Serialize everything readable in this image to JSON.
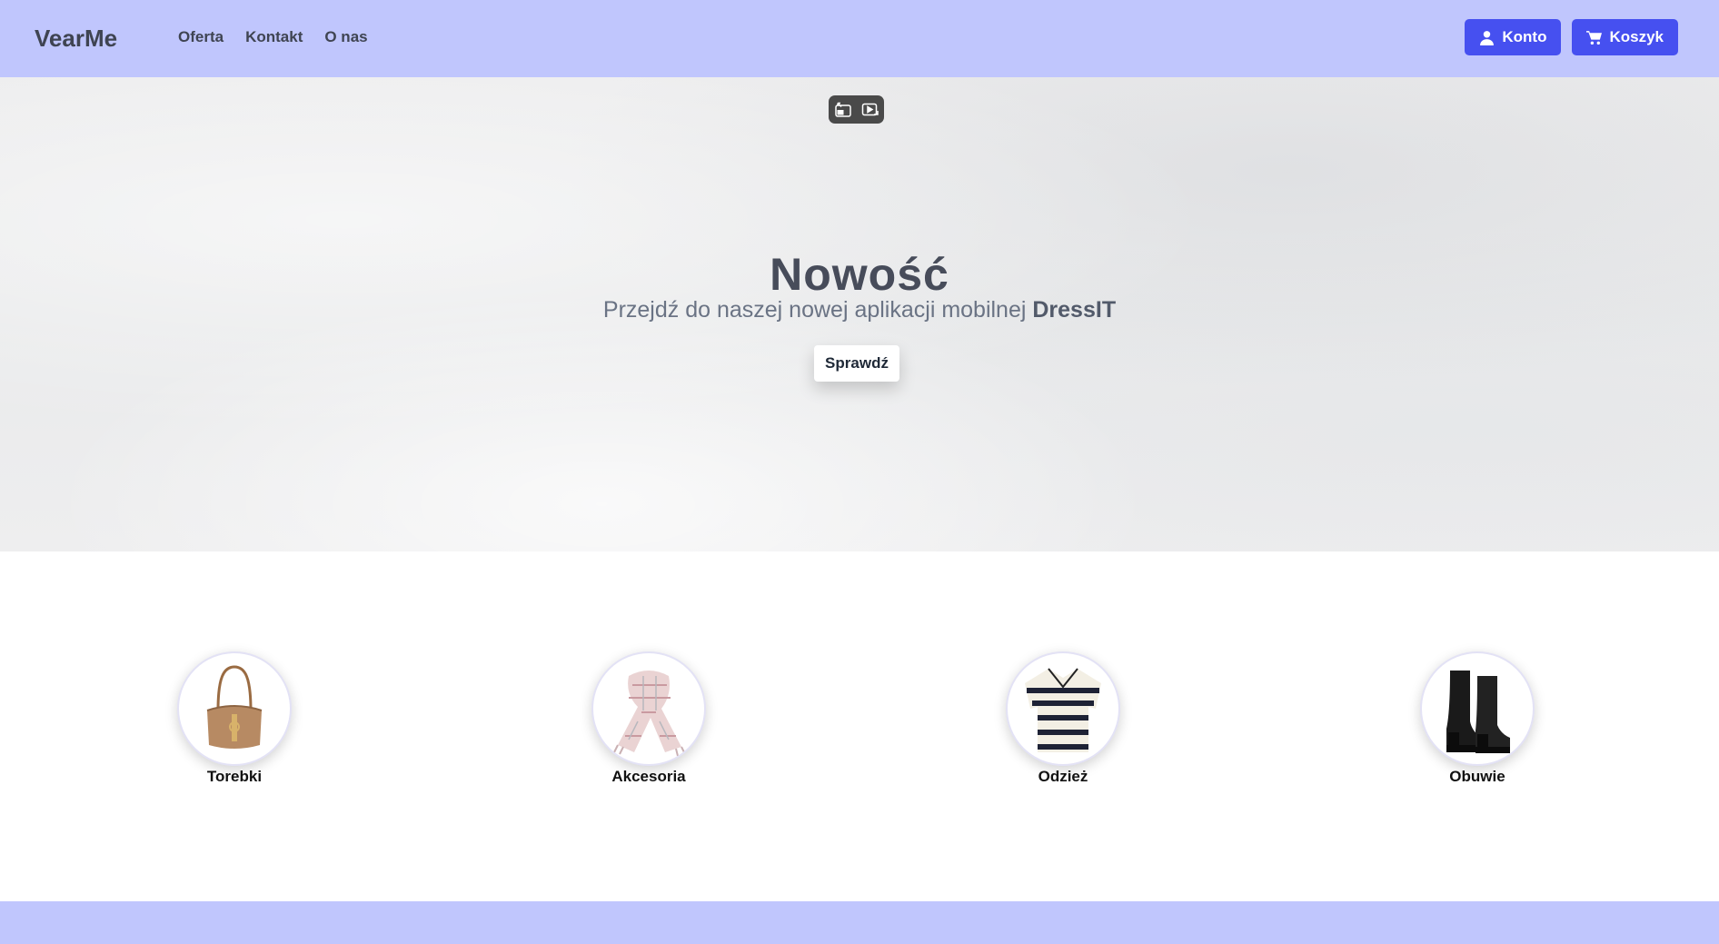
{
  "brand": "VearMe",
  "nav": {
    "links": [
      "Oferta",
      "Kontakt",
      "O nas"
    ],
    "account_label": "Konto",
    "cart_label": "Koszyk"
  },
  "hero": {
    "title": "Nowość",
    "subtitle_prefix": "Przejdź do naszej nowej aplikacji mobilnej",
    "subtitle_brand": "DressIT",
    "button_label": "Sprawdź"
  },
  "categories": [
    {
      "label": "Torebki",
      "icon": "handbag-icon"
    },
    {
      "label": "Akcesoria",
      "icon": "scarf-icon"
    },
    {
      "label": "Odzież",
      "icon": "striped-shirt-icon"
    },
    {
      "label": "Obuwie",
      "icon": "boots-icon"
    }
  ],
  "colors": {
    "navbar_bg": "#c0c6fd",
    "accent": "#4650f0",
    "footer_bg": "#c0c6fd"
  }
}
